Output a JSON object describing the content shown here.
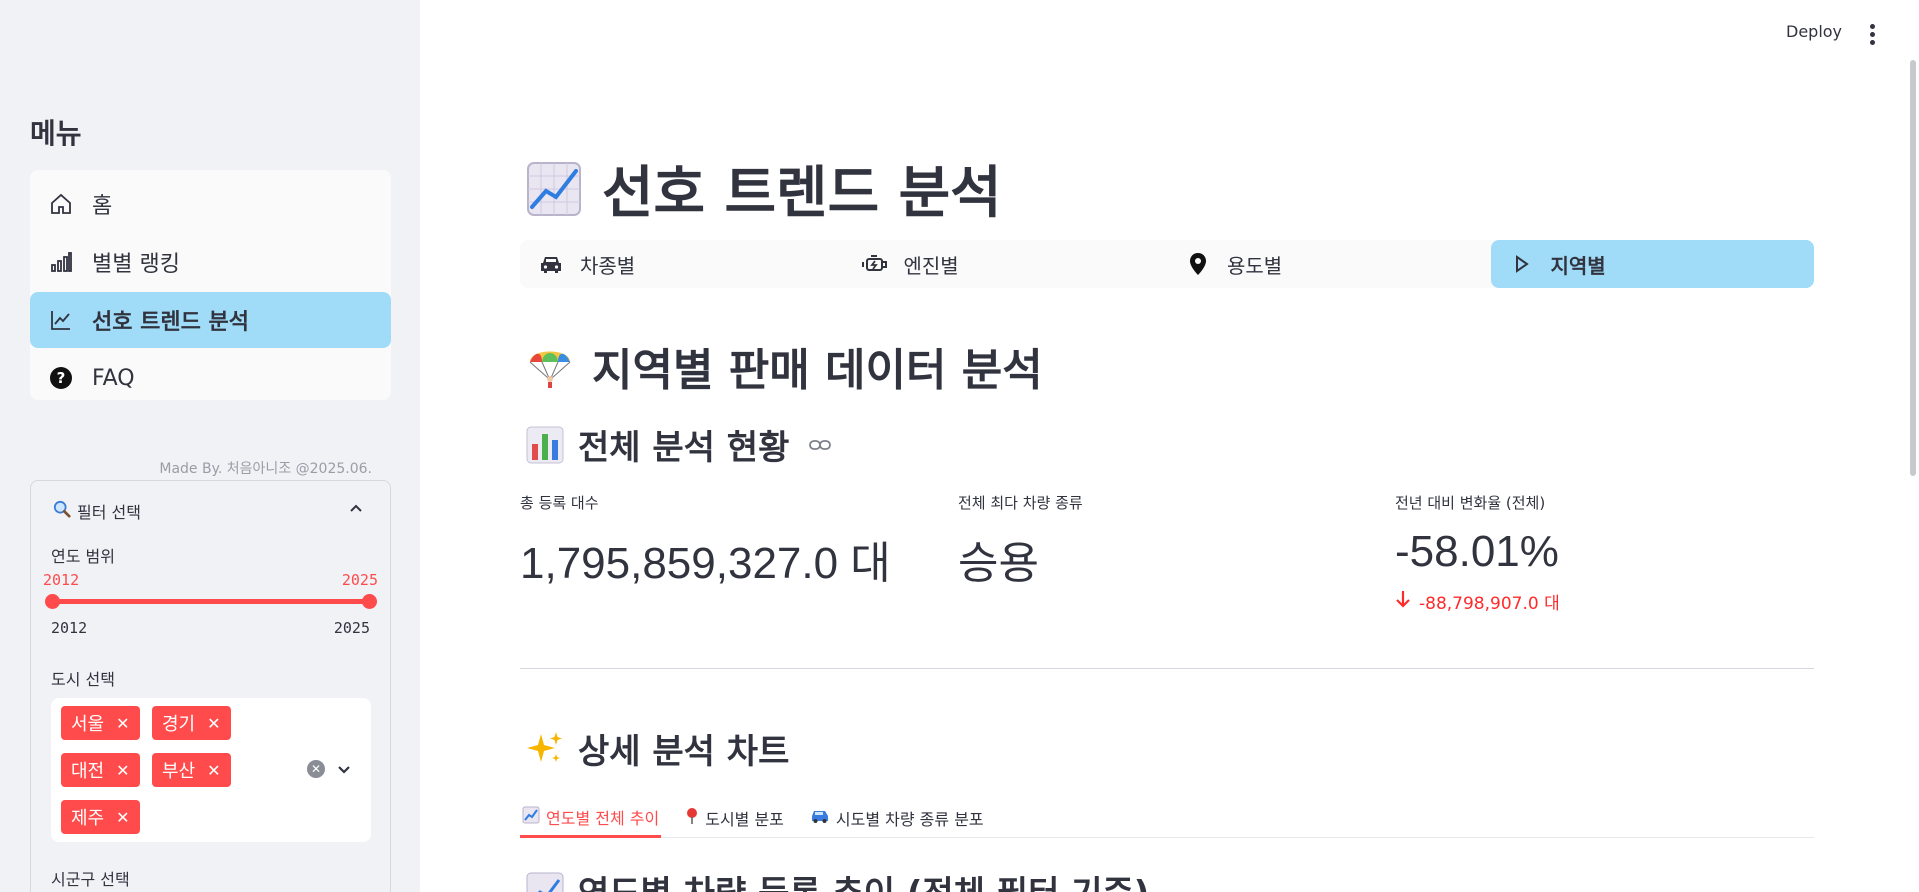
{
  "header": {
    "deploy_label": "Deploy"
  },
  "sidebar": {
    "menu_title": "메뉴",
    "items": [
      {
        "label": "홈",
        "icon": "home-icon",
        "active": false
      },
      {
        "label": "별별 랭킹",
        "icon": "bar-chart-icon",
        "active": false
      },
      {
        "label": "선호 트렌드 분석",
        "icon": "trend-chart-icon",
        "active": true
      },
      {
        "label": "FAQ",
        "icon": "question-circle-icon",
        "active": false
      }
    ],
    "made_by": "Made By. 처음아니조 @2025.06.",
    "filter": {
      "title": "필터 선택",
      "year_range_label": "연도 범위",
      "year_min_selected": "2012",
      "year_max_selected": "2025",
      "year_min": "2012",
      "year_max": "2025",
      "city_label": "도시 선택",
      "cities": [
        "서울",
        "경기",
        "대전",
        "부산",
        "제주"
      ],
      "district_label": "시군구 선택"
    }
  },
  "main": {
    "page_title": "선호 트렌드 분석",
    "nav": [
      {
        "label": "차종별",
        "icon": "car-icon"
      },
      {
        "label": "엔진별",
        "icon": "engine-icon"
      },
      {
        "label": "용도별",
        "icon": "location-pin-icon"
      },
      {
        "label": "지역별",
        "icon": "play-icon",
        "active": true
      }
    ],
    "section_title": "지역별 판매 데이터 분석",
    "overview_title": "전체 분석 현황",
    "metrics": [
      {
        "label": "총 등록 대수",
        "value": "1,795,859,327.0 대"
      },
      {
        "label": "전체 최다 차량 종류",
        "value": "승용"
      },
      {
        "label": "전년 대비 변화율 (전체)",
        "value": "-58.01%",
        "delta": "-88,798,907.0 대"
      }
    ],
    "detail_title": "상세 분석 차트",
    "tabs": [
      {
        "label": "연도별 전체 추이",
        "icon": "chart-up-emoji",
        "active": true
      },
      {
        "label": "도시별 분포",
        "icon": "pin-emoji"
      },
      {
        "label": "시도별 차량 종류 분포",
        "icon": "car-emoji"
      }
    ],
    "chart_heading": "연도별 차량 등록 추이 (전체 필터 기준)"
  },
  "colors": {
    "accent": "#ff4b4b",
    "active_bg": "#a0dcf8",
    "sidebar_bg": "#f0f2f6"
  }
}
